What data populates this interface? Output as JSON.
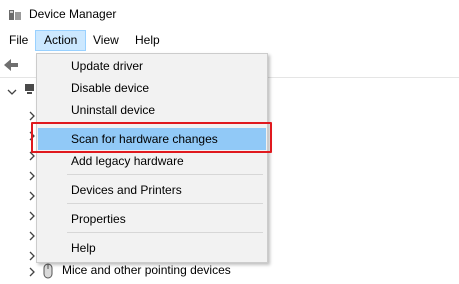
{
  "window": {
    "title": "Device Manager"
  },
  "menubar": {
    "file": "File",
    "action": "Action",
    "view": "View",
    "help": "Help"
  },
  "action_menu": {
    "items": [
      "Update driver",
      "Disable device",
      "Uninstall device",
      "Scan for hardware changes",
      "Add legacy hardware",
      "Devices and Printers",
      "Properties",
      "Help"
    ],
    "highlighted": "Scan for hardware changes"
  },
  "tree": {
    "visible_node": "Mice and other pointing devices"
  },
  "colors": {
    "highlight_border": "#e0191e",
    "hover_fill": "#91c9f7",
    "menu_active": "#cce8ff"
  }
}
